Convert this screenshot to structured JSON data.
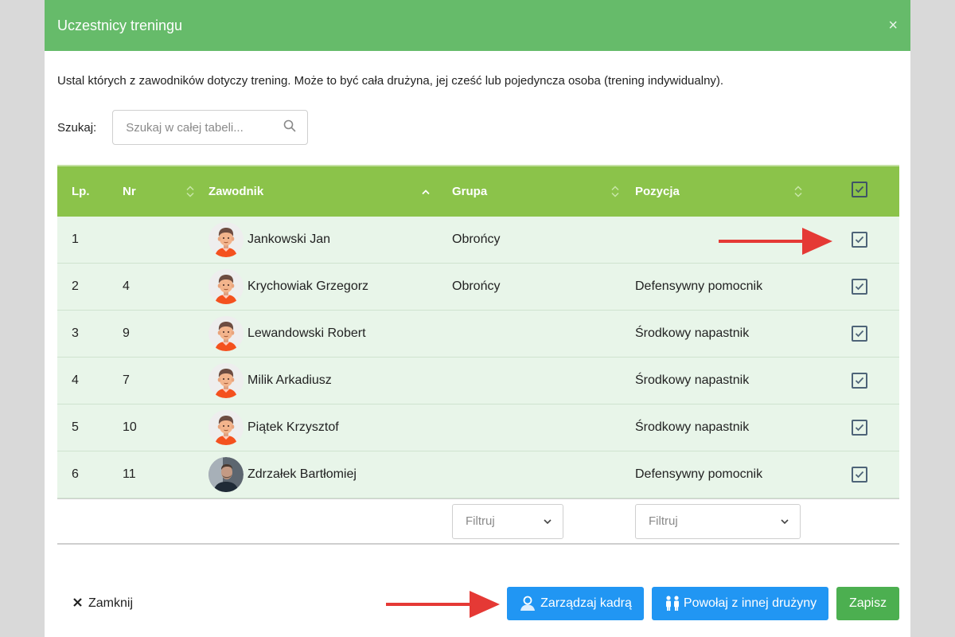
{
  "modal": {
    "title": "Uczestnicy treningu",
    "close_glyph": "×",
    "description": "Ustal których z zawodników dotyczy trening. Może to być cała drużyna, jej cześć lub pojedyncza osoba (trening indywidualny)."
  },
  "search": {
    "label": "Szukaj:",
    "placeholder": "Szukaj w całej tabeli...",
    "value": ""
  },
  "table": {
    "headers": {
      "lp": "Lp.",
      "nr": "Nr",
      "player": "Zawodnik",
      "group": "Grupa",
      "position": "Pozycja"
    },
    "rows": [
      {
        "lp": "1",
        "nr": "",
        "name": "Jankowski Jan",
        "group": "Obrońcy",
        "position": "",
        "checked": true,
        "avatar": "cartoon-player"
      },
      {
        "lp": "2",
        "nr": "4",
        "name": "Krychowiak Grzegorz",
        "group": "Obrońcy",
        "position": "Defensywny pomocnik",
        "checked": true,
        "avatar": "cartoon-player"
      },
      {
        "lp": "3",
        "nr": "9",
        "name": "Lewandowski Robert",
        "group": "",
        "position": "Środkowy napastnik",
        "checked": true,
        "avatar": "cartoon-player"
      },
      {
        "lp": "4",
        "nr": "7",
        "name": "Milik Arkadiusz",
        "group": "",
        "position": "Środkowy napastnik",
        "checked": true,
        "avatar": "cartoon-player"
      },
      {
        "lp": "5",
        "nr": "10",
        "name": "Piątek Krzysztof",
        "group": "",
        "position": "Środkowy napastnik",
        "checked": true,
        "avatar": "cartoon-player"
      },
      {
        "lp": "6",
        "nr": "11",
        "name": "Zdrzałek Bartłomiej",
        "group": "",
        "position": "Defensywny pomocnik",
        "checked": true,
        "avatar": "photo"
      }
    ],
    "filters": {
      "group": "Filtruj",
      "position": "Filtruj"
    }
  },
  "footer": {
    "close_label": "Zamknij",
    "manage_label": "Zarządzaj kadrą",
    "call_up_label": "Powołaj z innej drużyny",
    "save_label": "Zapisz"
  },
  "colors": {
    "header": "#66bb6a",
    "table_header": "#8bc34a",
    "row_bg": "#e8f5e9",
    "primary": "#2196f3",
    "success": "#4caf50",
    "annotation_arrow": "#e53935"
  }
}
